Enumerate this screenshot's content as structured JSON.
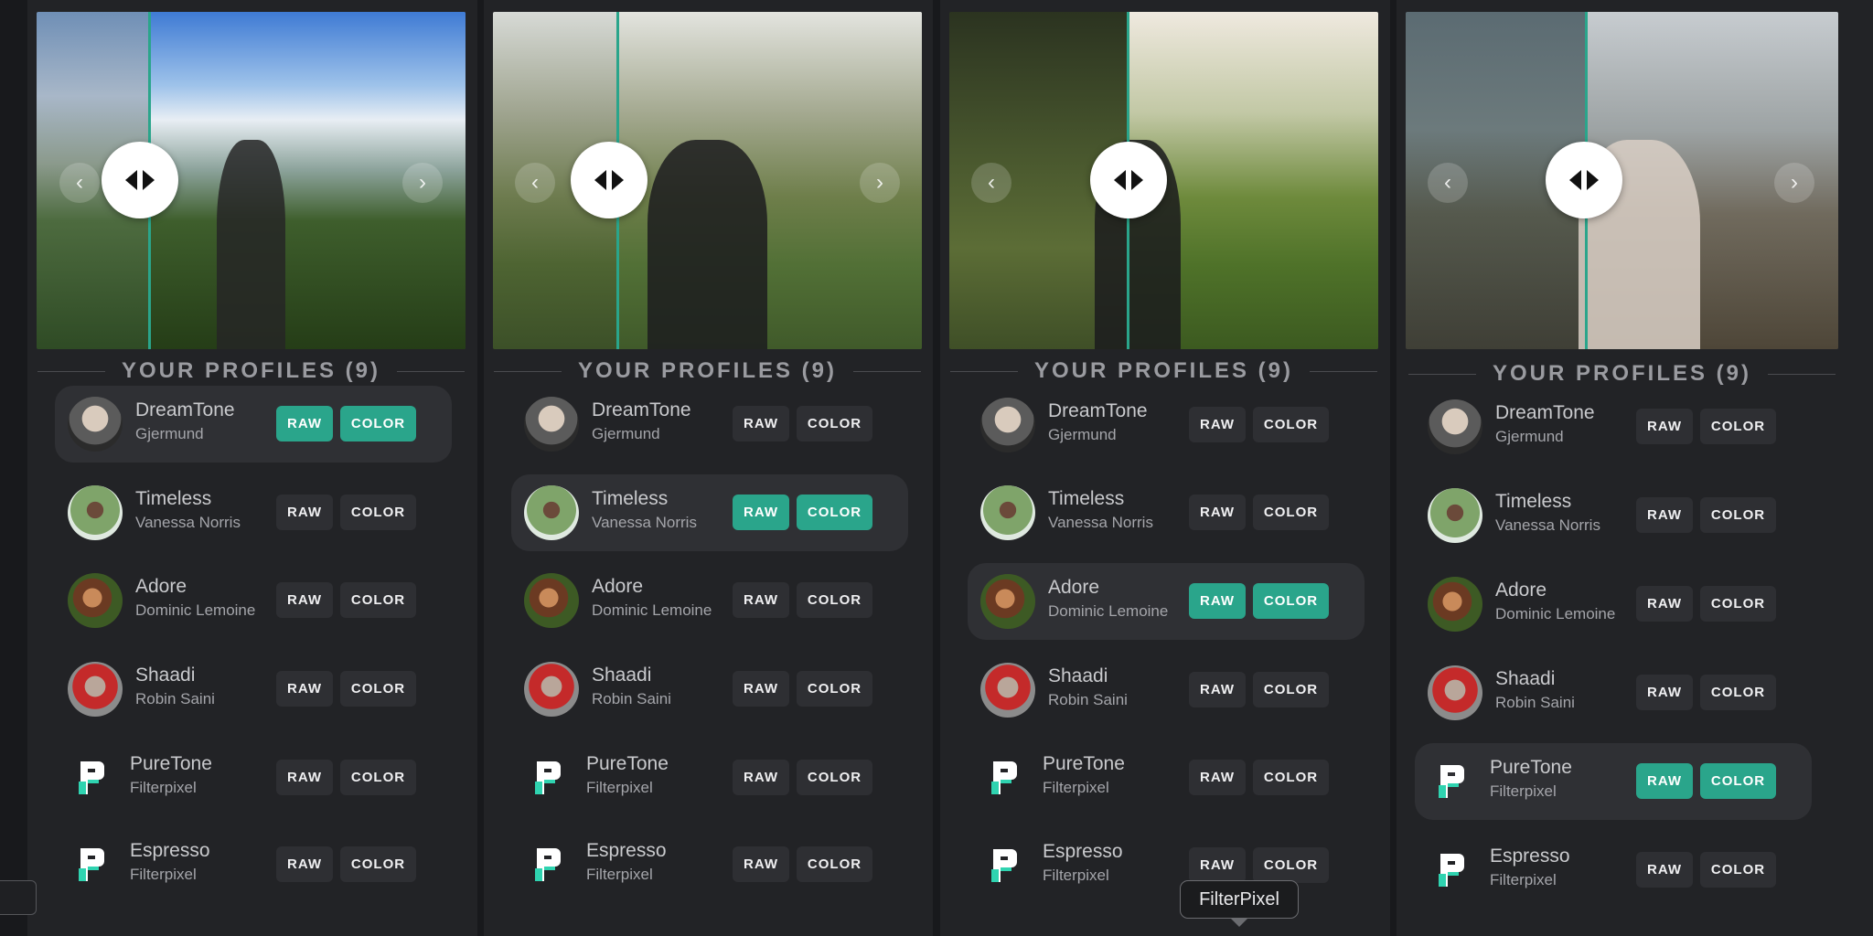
{
  "heading": "YOUR PROFILES (9)",
  "raw_label": "RAW",
  "color_label": "COLOR",
  "tooltip": "FilterPixel",
  "accent": "#2aa58b",
  "profiles": [
    {
      "title": "DreamTone",
      "author": "Gjermund",
      "avatar": "avatar-gjermund"
    },
    {
      "title": "Timeless",
      "author": "Vanessa Norris",
      "avatar": "avatar-vanessa"
    },
    {
      "title": "Adore",
      "author": "Dominic Lemoine",
      "avatar": "avatar-dominic"
    },
    {
      "title": "Shaadi",
      "author": "Robin Saini",
      "avatar": "avatar-robin"
    },
    {
      "title": "PureTone",
      "author": "Filterpixel",
      "avatar": "filterpixel-logo"
    },
    {
      "title": "Espresso",
      "author": "Filterpixel",
      "avatar": "filterpixel-logo"
    }
  ],
  "panels": [
    {
      "active": 0,
      "scene": "woman-apron-mountains"
    },
    {
      "active": 1,
      "scene": "wedding-couple-garden"
    },
    {
      "active": 2,
      "scene": "wedding-kiss-hedges"
    },
    {
      "active": 4,
      "scene": "woman-lace-horse"
    }
  ]
}
